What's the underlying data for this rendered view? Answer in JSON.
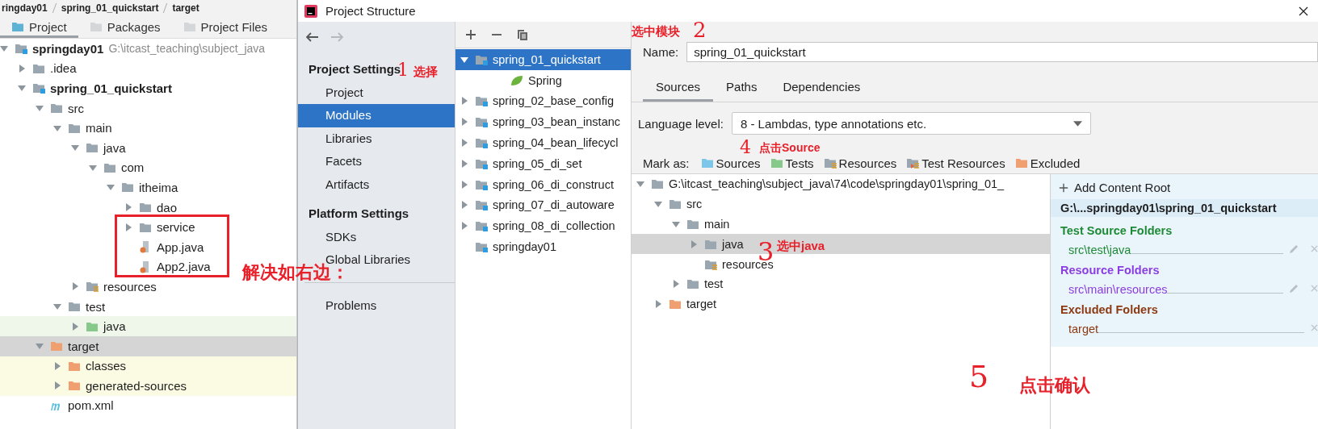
{
  "breadcrumb": [
    "ringday01",
    "spring_01_quickstart",
    "target"
  ],
  "project_panel": {
    "tabs": [
      {
        "label": "Project",
        "selected": true
      },
      {
        "label": "Packages",
        "selected": false
      },
      {
        "label": "Project Files",
        "selected": false
      }
    ],
    "tree": [
      {
        "label": "springday01",
        "path": "G:\\itcast_teaching\\subject_java",
        "kind": "module",
        "bold": true,
        "expanded": true,
        "selected": false,
        "children": [
          {
            "label": ".idea",
            "kind": "folder",
            "bold": false,
            "expanded": false,
            "selected": false
          },
          {
            "label": "spring_01_quickstart",
            "kind": "module",
            "bold": true,
            "expanded": true,
            "selected": false,
            "children": [
              {
                "label": "src",
                "kind": "folder",
                "bold": false,
                "expanded": true,
                "selected": false,
                "children": [
                  {
                    "label": "main",
                    "kind": "folder",
                    "bold": false,
                    "expanded": true,
                    "selected": false,
                    "children": [
                      {
                        "label": "java",
                        "kind": "folder",
                        "bold": false,
                        "expanded": true,
                        "selected": false,
                        "children": [
                          {
                            "label": "com",
                            "kind": "folder",
                            "bold": false,
                            "expanded": true,
                            "selected": false,
                            "children": [
                              {
                                "label": "itheima",
                                "kind": "folder",
                                "bold": false,
                                "expanded": true,
                                "selected": false,
                                "children": [
                                  {
                                    "label": "dao",
                                    "kind": "folder",
                                    "bold": false,
                                    "expanded": false,
                                    "selected": false
                                  },
                                  {
                                    "label": "service",
                                    "kind": "folder",
                                    "bold": false,
                                    "expanded": false,
                                    "selected": false
                                  },
                                  {
                                    "label": "App.java",
                                    "kind": "java-file",
                                    "bold": false,
                                    "selected": false
                                  },
                                  {
                                    "label": "App2.java",
                                    "kind": "java-file",
                                    "bold": false,
                                    "selected": false
                                  }
                                ]
                              }
                            ]
                          }
                        ]
                      },
                      {
                        "label": "resources",
                        "kind": "resources-folder",
                        "bold": false,
                        "expanded": false,
                        "selected": false
                      }
                    ]
                  },
                  {
                    "label": "test",
                    "kind": "folder",
                    "bold": false,
                    "expanded": true,
                    "selected": false,
                    "children": [
                      {
                        "label": "java",
                        "kind": "test-folder",
                        "bold": false,
                        "expanded": false,
                        "selected": false
                      }
                    ]
                  }
                ]
              },
              {
                "label": "target",
                "kind": "excluded-folder",
                "bold": false,
                "expanded": true,
                "selected": true,
                "children": [
                  {
                    "label": "classes",
                    "kind": "excluded-folder",
                    "bold": false,
                    "expanded": false,
                    "selected": false
                  },
                  {
                    "label": "generated-sources",
                    "kind": "excluded-folder",
                    "bold": false,
                    "expanded": false,
                    "selected": false
                  }
                ]
              },
              {
                "label": "pom.xml",
                "kind": "maven-file",
                "bold": false,
                "selected": false
              }
            ]
          }
        ]
      }
    ]
  },
  "window": {
    "title": "Project Structure"
  },
  "nav": {
    "sections": [
      {
        "title": "Project Settings",
        "items": [
          {
            "label": "Project",
            "selected": false
          },
          {
            "label": "Modules",
            "selected": true
          },
          {
            "label": "Libraries",
            "selected": false
          },
          {
            "label": "Facets",
            "selected": false
          },
          {
            "label": "Artifacts",
            "selected": false
          }
        ]
      },
      {
        "title": "Platform Settings",
        "items": [
          {
            "label": "SDKs",
            "selected": false
          },
          {
            "label": "Global Libraries",
            "selected": false
          }
        ]
      }
    ],
    "footer_items": [
      {
        "label": "Problems",
        "selected": false
      }
    ]
  },
  "modules": [
    {
      "label": "spring_01_quickstart",
      "kind": "module",
      "expanded": true,
      "selected": true,
      "children": [
        {
          "label": "Spring",
          "kind": "facet",
          "selected": false
        }
      ]
    },
    {
      "label": "spring_02_base_config",
      "kind": "module",
      "expanded": false,
      "selected": false
    },
    {
      "label": "spring_03_bean_instanc",
      "kind": "module",
      "expanded": false,
      "selected": false
    },
    {
      "label": "spring_04_bean_lifecycl",
      "kind": "module",
      "expanded": false,
      "selected": false
    },
    {
      "label": "spring_05_di_set",
      "kind": "module",
      "expanded": false,
      "selected": false
    },
    {
      "label": "spring_06_di_construct",
      "kind": "module",
      "expanded": false,
      "selected": false
    },
    {
      "label": "spring_07_di_autoware",
      "kind": "module",
      "expanded": false,
      "selected": false
    },
    {
      "label": "spring_08_di_collection",
      "kind": "module",
      "expanded": false,
      "selected": false
    },
    {
      "label": "springday01",
      "kind": "module",
      "selected": false
    }
  ],
  "module_form": {
    "name_label": "Name:",
    "name_value": "spring_01_quickstart",
    "tabs": [
      {
        "label": "Sources",
        "selected": true
      },
      {
        "label": "Paths",
        "selected": false
      },
      {
        "label": "Dependencies",
        "selected": false
      }
    ],
    "language_level_label": "Language level:",
    "language_level": "8 - Lambdas, type annotations etc.",
    "mark_as_label": "Mark as:",
    "mark_buttons": [
      {
        "label": "Sources",
        "kind": "source-folder"
      },
      {
        "label": "Tests",
        "kind": "test-folder"
      },
      {
        "label": "Resources",
        "kind": "resources-folder"
      },
      {
        "label": "Test Resources",
        "kind": "test-resources-folder"
      },
      {
        "label": "Excluded",
        "kind": "excluded-folder"
      }
    ],
    "content_tree": [
      {
        "label": "G:\\itcast_teaching\\subject_java\\74\\code\\springday01\\spring_01_",
        "kind": "folder",
        "expanded": true,
        "selected": false,
        "children": [
          {
            "label": "src",
            "kind": "folder",
            "expanded": true,
            "selected": false,
            "children": [
              {
                "label": "main",
                "kind": "folder",
                "expanded": true,
                "selected": false,
                "children": [
                  {
                    "label": "java",
                    "kind": "folder",
                    "expanded": false,
                    "selected": true
                  },
                  {
                    "label": "resources",
                    "kind": "resources-folder",
                    "selected": false
                  }
                ]
              },
              {
                "label": "test",
                "kind": "folder",
                "expanded": false,
                "selected": false
              }
            ]
          },
          {
            "label": "target",
            "kind": "excluded-folder",
            "expanded": false,
            "selected": false
          }
        ]
      }
    ],
    "content_roots": {
      "add_label": "Add Content Root",
      "root": "G:\\...springday01\\spring_01_quickstart",
      "groups": [
        {
          "title": "Test Source Folders",
          "color": "#1f8a36",
          "editable": true,
          "items": [
            "src\\test\\java"
          ]
        },
        {
          "title": "Resource Folders",
          "color": "#8a3ee0",
          "editable": true,
          "items": [
            "src\\main\\resources"
          ]
        },
        {
          "title": "Excluded Folders",
          "color": "#8c3a12",
          "editable": false,
          "items": [
            "target"
          ]
        }
      ]
    }
  },
  "annotations": {
    "module_step": "2",
    "module_note": "选中模块",
    "modules_step": "1",
    "modules_note": "选择",
    "source_step": "4",
    "source_note": "点击Source",
    "java_step": "3",
    "java_note": "选中java",
    "confirm_step": "5",
    "confirm_note": "点击确认",
    "fix_note": "解决如右边："
  }
}
